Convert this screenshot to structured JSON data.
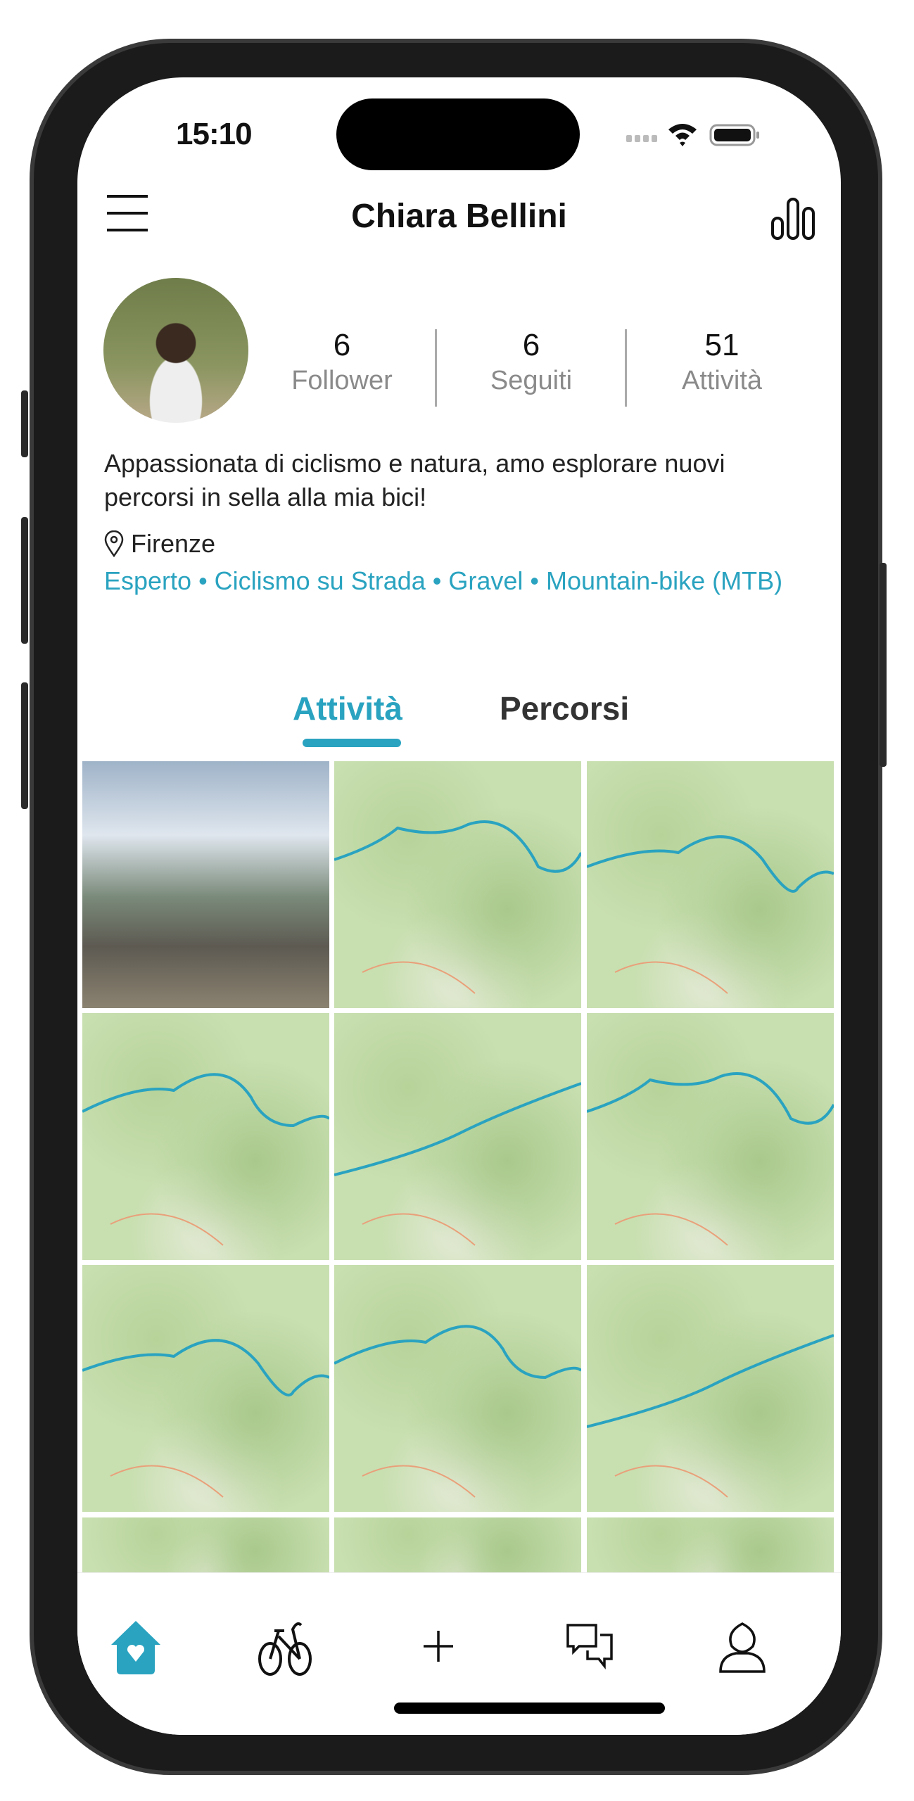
{
  "status_bar": {
    "time": "15:10"
  },
  "header": {
    "title": "Chiara Bellini",
    "menu_icon": "hamburger-icon",
    "stats_icon": "bar-chart-icon"
  },
  "profile": {
    "stats": [
      {
        "value": "6",
        "label": "Follower"
      },
      {
        "value": "6",
        "label": "Seguiti"
      },
      {
        "value": "51",
        "label": "Attività"
      }
    ],
    "bio": "Appassionata di ciclismo e natura, amo esplorare nuovi percorsi in sella alla mia bici!",
    "location": "Firenze",
    "tags": "Esperto • Ciclismo su Strada • Gravel • Mountain-bike (MTB)"
  },
  "tabs": [
    {
      "label": "Attività",
      "active": true
    },
    {
      "label": "Percorsi",
      "active": false
    }
  ],
  "grid": {
    "items": [
      "photo",
      "map",
      "map",
      "map",
      "map",
      "map",
      "map",
      "map",
      "map",
      "map",
      "map",
      "map"
    ]
  },
  "tabbar": {
    "items": [
      "home-icon",
      "bike-icon",
      "plus-icon",
      "chat-icon",
      "profile-icon"
    ],
    "active": 0
  },
  "colors": {
    "accent": "#2aa3c0",
    "route": "#2aa3c0"
  }
}
